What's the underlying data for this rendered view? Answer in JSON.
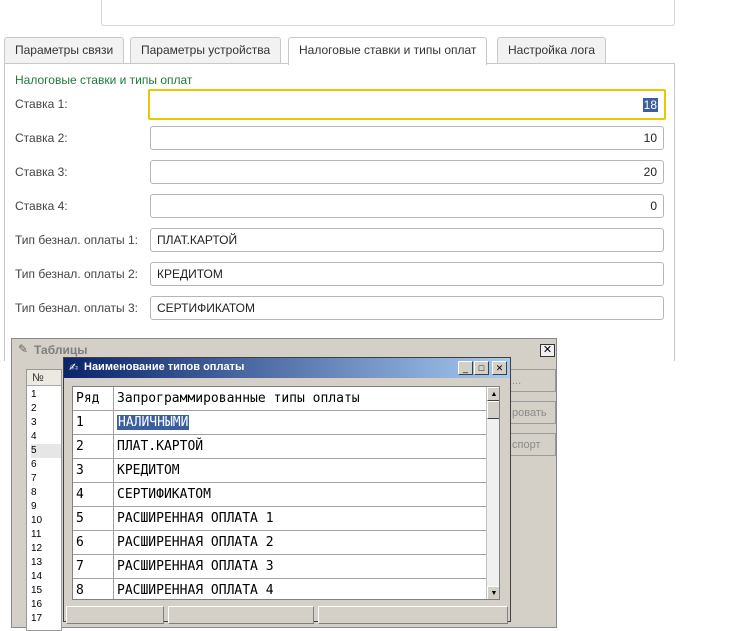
{
  "tabs": [
    "Параметры связи",
    "Параметры устройства",
    "Налоговые ставки и типы оплат",
    "Настройка лога"
  ],
  "active_tab": 2,
  "group_title": "Налоговые ставки и типы оплат",
  "fields": [
    {
      "label": "Ставка 1:",
      "value": "18"
    },
    {
      "label": "Ставка 2:",
      "value": "10"
    },
    {
      "label": "Ставка 3:",
      "value": "20"
    },
    {
      "label": "Ставка 4:",
      "value": "0"
    },
    {
      "label": "Тип безнал. оплаты 1:",
      "value": "ПЛАТ.КАРТОЙ"
    },
    {
      "label": "Тип безнал. оплаты 2:",
      "value": "КРЕДИТОМ"
    },
    {
      "label": "Тип безнал. оплаты 3:",
      "value": "СЕРТИФИКАТОМ"
    }
  ],
  "tables_window": {
    "title": "Таблицы",
    "close": "✕",
    "num_header": "№",
    "numbers": [
      "1",
      "2",
      "3",
      "4",
      "5",
      "6",
      "7",
      "8",
      "9",
      "10",
      "11",
      "12",
      "13",
      "14",
      "15",
      "16",
      "17"
    ],
    "selected_number": "5",
    "buttons": [
      "...",
      "ровать",
      "спорт"
    ]
  },
  "dialog": {
    "title": "Наименование типов оплаты",
    "min": "_",
    "max": "□",
    "close": "✕",
    "columns": [
      "Ряд",
      "Запрограммированные типы оплаты"
    ],
    "rows": [
      {
        "n": "1",
        "name": "НАЛИЧНЫМИ"
      },
      {
        "n": "2",
        "name": "ПЛАТ.КАРТОЙ"
      },
      {
        "n": "3",
        "name": "КРЕДИТОМ"
      },
      {
        "n": "4",
        "name": "СЕРТИФИКАТОМ"
      },
      {
        "n": "5",
        "name": "РАСШИРЕННАЯ ОПЛАТА 1"
      },
      {
        "n": "6",
        "name": "РАСШИРЕННАЯ ОПЛАТА 2"
      },
      {
        "n": "7",
        "name": "РАСШИРЕННАЯ ОПЛАТА 3"
      },
      {
        "n": "8",
        "name": "РАСШИРЕННАЯ ОПЛАТА 4"
      }
    ],
    "scroll_up": "▲",
    "scroll_down": "▼"
  }
}
